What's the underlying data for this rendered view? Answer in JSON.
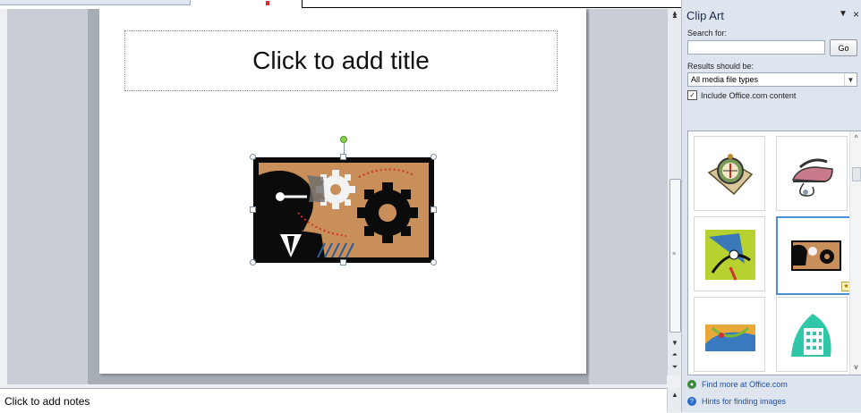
{
  "slide": {
    "title_placeholder": "Click to add title"
  },
  "notes": {
    "placeholder": "Click to add notes"
  },
  "clip_art_pane": {
    "title": "Clip Art",
    "search_label": "Search for:",
    "search_value": "",
    "go_label": "Go",
    "results_label": "Results should be:",
    "results_value": "All media file types",
    "include_label": "Include Office.com content",
    "include_checked": true,
    "results": [
      {
        "name": "compass-map"
      },
      {
        "name": "clothes-iron"
      },
      {
        "name": "satellite-dish"
      },
      {
        "name": "businessman-gears",
        "selected": true
      },
      {
        "name": "circuit-scene"
      },
      {
        "name": "office-building"
      }
    ],
    "links": {
      "find_more": "Find more at Office.com",
      "hints": "Hints for finding images"
    }
  },
  "colors": {
    "selection_border": "#4a8fd8",
    "link": "#1f4fa8",
    "rotate_handle": "#8ad05a"
  }
}
